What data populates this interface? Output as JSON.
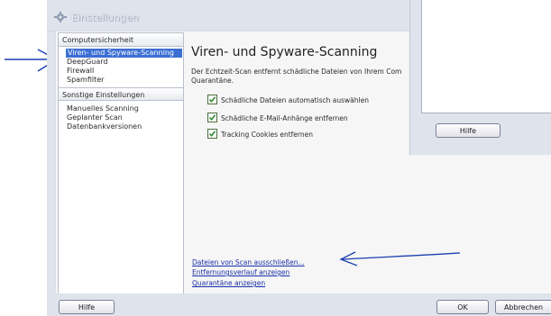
{
  "window": {
    "title": "Einstellungen",
    "icon": "gear-icon"
  },
  "nav": {
    "sections": [
      {
        "header": "Computersicherheit",
        "items": [
          "Viren- und Spyware-Scanning",
          "DeepGuard",
          "Firewall",
          "Spamfilter"
        ]
      },
      {
        "header": "Sonstige Einstellungen",
        "items": [
          "Manuelles Scanning",
          "Geplanter Scan",
          "Datenbankversionen"
        ]
      }
    ],
    "selected": "Viren- und Spyware-Scanning"
  },
  "content": {
    "title": "Viren- und Spyware-Scanning",
    "description": "Der Echtzeit-Scan entfernt schädliche Dateien von Ihrem Com Quarantäne.",
    "options": [
      {
        "label": "Schädliche Dateien automatisch auswählen",
        "checked": true
      },
      {
        "label": "Schädliche E-Mail-Anhänge entfernen",
        "checked": true
      },
      {
        "label": "Tracking Cookies entfernen",
        "checked": true
      }
    ],
    "links": [
      "Dateien von Scan ausschließen...",
      "Entfernungsverlauf anzeigen",
      "Quarantäne anzeigen"
    ]
  },
  "overlay": {
    "help_label": "Hilfe"
  },
  "footer": {
    "help_label": "Hilfe",
    "ok_label": "OK",
    "cancel_label": "Abbrechen"
  },
  "colors": {
    "selection": "#3b6fd3",
    "annotation": "#1a3fb0",
    "link": "#1a2fa8"
  }
}
